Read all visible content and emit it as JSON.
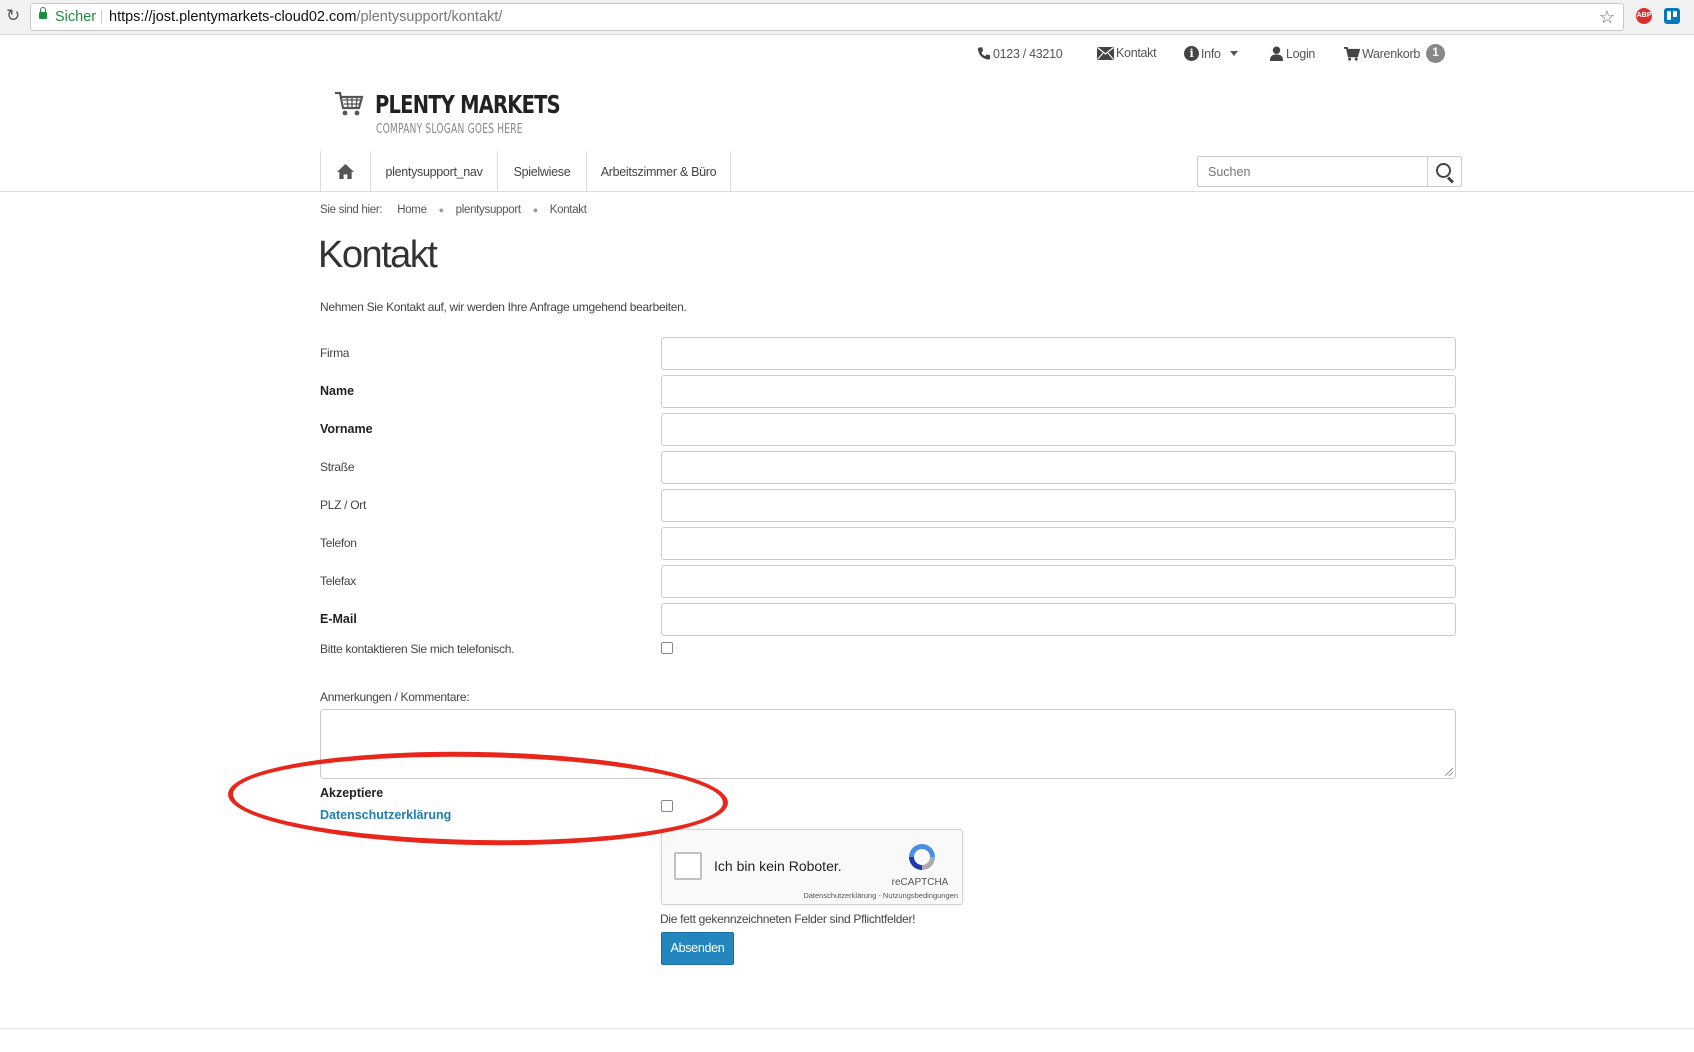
{
  "browser": {
    "secure_label": "Sicher",
    "url_host": "https://jost.plentymarkets-cloud02.com",
    "url_path": "/plentysupport/kontakt/",
    "extension_abp": "ABP"
  },
  "topnav": {
    "phone": "0123 / 43210",
    "contact": "Kontakt",
    "info": "Info",
    "login": "Login",
    "cart": "Warenkorb",
    "cart_count": "1"
  },
  "logo": {
    "title": "PLENTY MARKETS",
    "slogan": "COMPANY SLOGAN GOES HERE"
  },
  "mainnav": {
    "items": [
      "plentysupport_nav",
      "Spielwiese",
      "Arbeitszimmer & Büro"
    ]
  },
  "search": {
    "placeholder": "Suchen"
  },
  "breadcrumb": {
    "prefix": "Sie sind hier:",
    "items": [
      "Home",
      "plentysupport",
      "Kontakt"
    ]
  },
  "page": {
    "title": "Kontakt",
    "intro": "Nehmen Sie Kontakt auf, wir werden Ihre Anfrage umgehend bearbeiten."
  },
  "form": {
    "fields": [
      {
        "label": "Firma",
        "required": false,
        "value": ""
      },
      {
        "label": "Name",
        "required": true,
        "value": ""
      },
      {
        "label": "Vorname",
        "required": true,
        "value": ""
      },
      {
        "label": "Straße",
        "required": false,
        "value": ""
      },
      {
        "label": "PLZ / Ort",
        "required": false,
        "value": ""
      },
      {
        "label": "Telefon",
        "required": false,
        "value": ""
      },
      {
        "label": "Telefax",
        "required": false,
        "value": ""
      },
      {
        "label": "E-Mail",
        "required": true,
        "value": ""
      }
    ],
    "callback_label": "Bitte kontaktieren Sie mich telefonisch.",
    "callback_checked": false,
    "comments_label": "Anmerkungen / Kommentare:",
    "comments_value": "",
    "accept_label": "Akzeptiere",
    "privacy_link": "Datenschutzerklärung",
    "accept_checked": false,
    "recaptcha": {
      "label": "Ich bin kein Roboter.",
      "brand": "reCAPTCHA",
      "terms": "Datenschutzerklärung - Nutzungsbedingungen"
    },
    "required_note": "Die fett gekennzeichneten Felder sind Pflichtfelder!",
    "submit_label": "Absenden"
  },
  "colors": {
    "link_blue": "#1d7fb3",
    "button_blue": "#2486bf",
    "annotation_red": "#e8261b",
    "secure_green": "#1e8e3e"
  }
}
